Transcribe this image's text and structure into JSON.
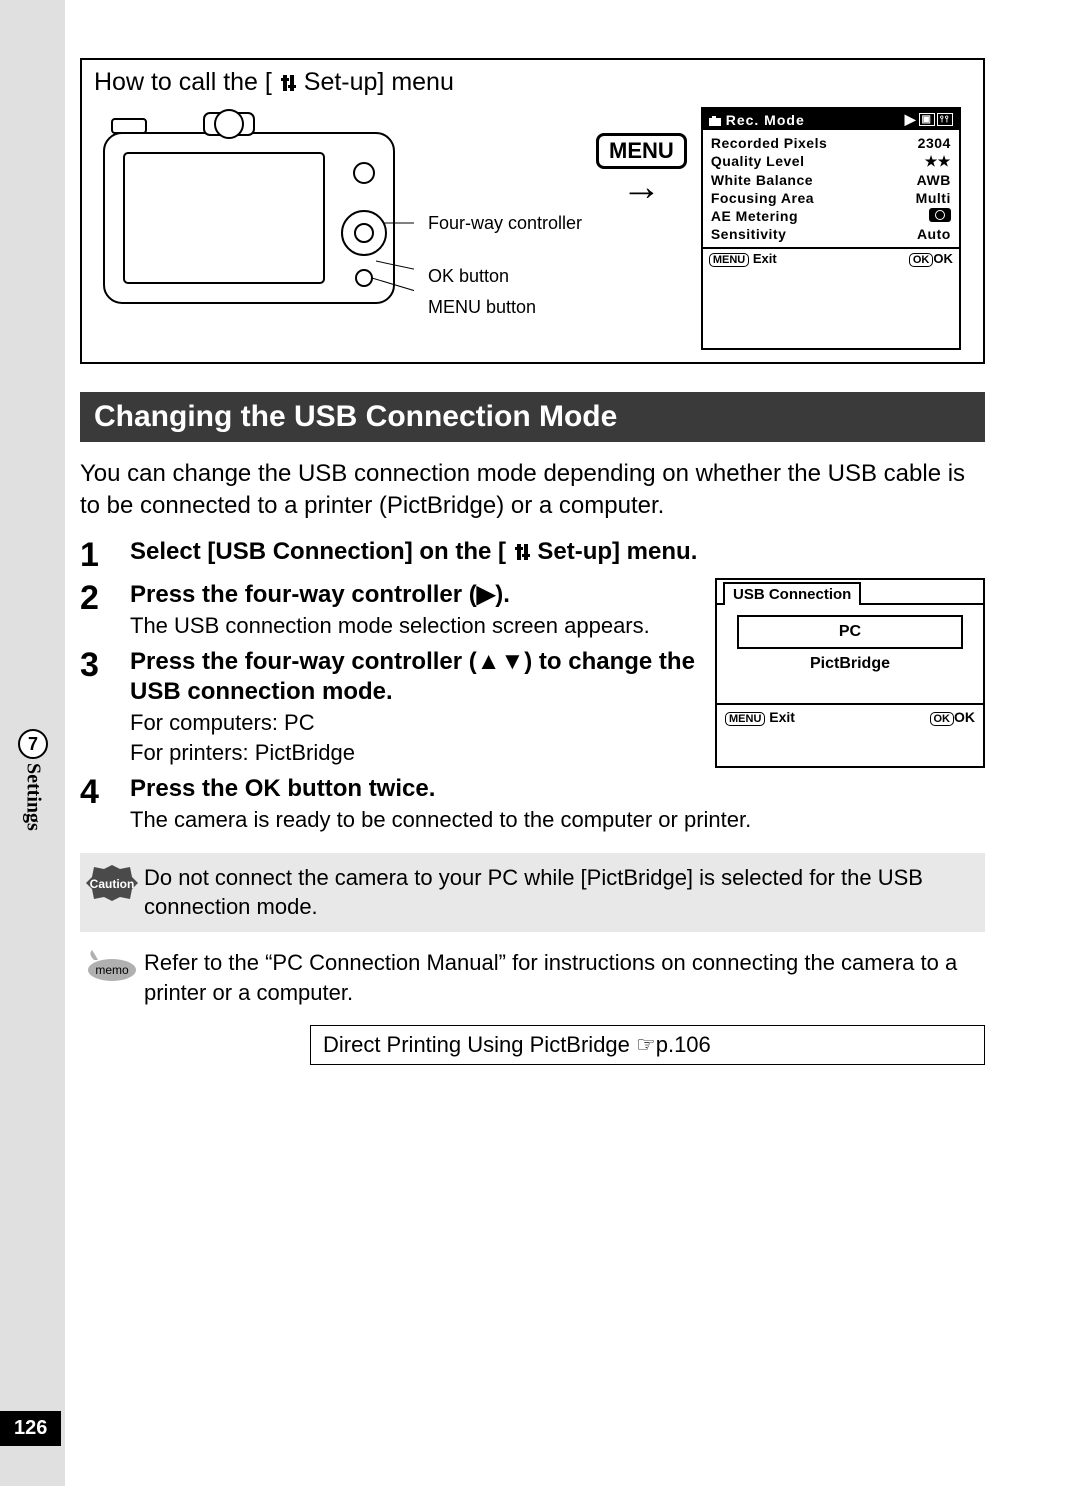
{
  "page_number": "126",
  "side_tab": {
    "chapter": "7",
    "label": "Settings"
  },
  "setup_box": {
    "title_prefix": "How to call the [",
    "title_suffix": " Set-up] menu",
    "labels": {
      "four_way": "Four-way controller",
      "ok_btn": "OK button",
      "menu_btn": "MENU button"
    },
    "menu_button": "MENU"
  },
  "lcd": {
    "header_left": "Rec. Mode",
    "rows": [
      {
        "l": "Recorded Pixels",
        "r": "2304"
      },
      {
        "l": "Quality Level",
        "r": "★★"
      },
      {
        "l": "White Balance",
        "r": "AWB"
      },
      {
        "l": "Focusing Area",
        "r": "Multi"
      },
      {
        "l": "AE Metering",
        "r": ""
      },
      {
        "l": "Sensitivity",
        "r": "Auto"
      }
    ],
    "footer_exit": "Exit",
    "footer_ok": "OK"
  },
  "heading": "Changing the USB Connection Mode",
  "intro": "You can change the USB connection mode depending on whether the USB cable is to be connected to a printer (PictBridge) or a computer.",
  "steps": {
    "s1": {
      "num": "1",
      "head_prefix": "Select [USB Connection] on the [",
      "head_suffix": " Set-up] menu."
    },
    "s2": {
      "num": "2",
      "head": "Press the four-way controller (▶).",
      "text": "The USB connection mode selection screen appears."
    },
    "s3": {
      "num": "3",
      "head": "Press the four-way controller (▲▼) to change the USB connection mode.",
      "text1": "For computers: PC",
      "text2": "For printers: PictBridge"
    },
    "s4": {
      "num": "4",
      "head": "Press the OK button twice.",
      "text": "The camera is ready to be connected to the computer or printer."
    }
  },
  "usb_box": {
    "tab": "USB Connection",
    "opt1": "PC",
    "opt2": "PictBridge",
    "footer_exit": "Exit",
    "footer_ok": "OK"
  },
  "caution": {
    "label": "Caution",
    "text": "Do not connect the camera to your PC while [PictBridge] is selected for the USB connection mode."
  },
  "memo": {
    "label": "memo",
    "text": "Refer to the “PC Connection Manual” for instructions on connecting the camera to a printer or a computer."
  },
  "link_box": "Direct Printing Using PictBridge ☞p.106"
}
